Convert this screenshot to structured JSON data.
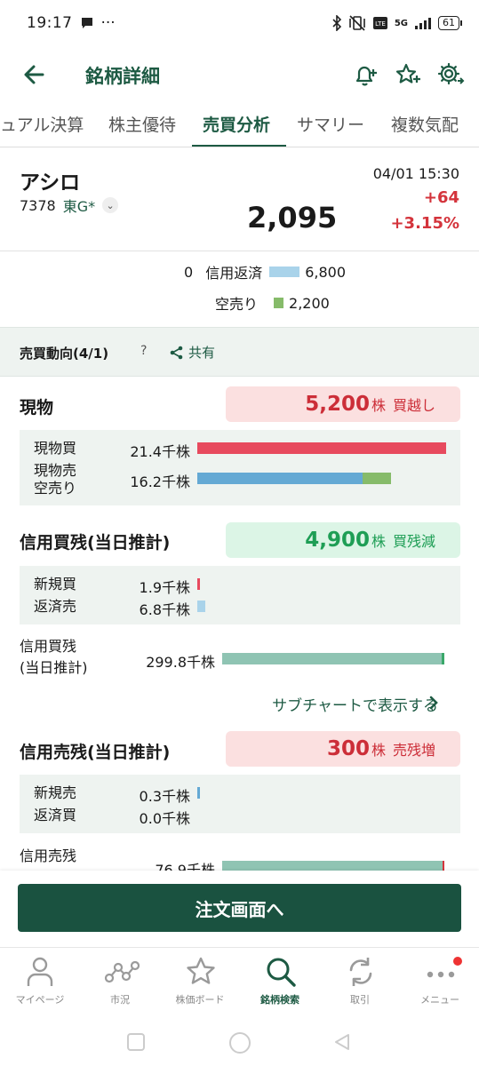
{
  "status_bar": {
    "time": "19:17",
    "dots": "···",
    "network": "5G",
    "battery": "61"
  },
  "header": {
    "title": "銘柄詳細"
  },
  "tabs": [
    {
      "label": "ュアル決算"
    },
    {
      "label": "株主優待"
    },
    {
      "label": "売買分析"
    },
    {
      "label": "サマリー"
    },
    {
      "label": "複数気配"
    }
  ],
  "stock": {
    "name": "アシロ",
    "code": "7378",
    "market": "東G*",
    "price": "2,095",
    "datetime": "04/01 15:30",
    "change": "+64",
    "change_pct": "+3.15%"
  },
  "credit": {
    "left_value": "0",
    "repay_label": "信用返済",
    "repay_value": "6,800",
    "short_label": "空売り",
    "short_value": "2,200",
    "colors": {
      "repay": "#a9d3ea",
      "short": "#86bb6a"
    }
  },
  "trend": {
    "title": "売買動向(4/1)",
    "help": "?",
    "share": "共有"
  },
  "spot": {
    "title": "現物",
    "summary_num": "5,200",
    "summary_unit": "株",
    "summary_label": "買越し",
    "buy_label": "現物買",
    "buy_value": "21.4千株",
    "sell_label_1": "現物売",
    "sell_label_2": "空売り",
    "sell_value": "16.2千株",
    "buy_fraction": 1.0,
    "sell_fraction": 0.663,
    "short_fraction": 0.114
  },
  "margin_buy": {
    "title": "信用買残(当日推計)",
    "summary_num": "4,900",
    "summary_unit": "株",
    "summary_label": "買残減",
    "new_label": "新規買",
    "new_value": "1.9千株",
    "repay_label": "返済売",
    "repay_value": "6.8千株",
    "total_label_1": "信用買残",
    "total_label_2": "(当日推計)",
    "total_value": "299.8千株",
    "link": "サブチャートで表示する"
  },
  "margin_sell": {
    "title": "信用売残(当日推計)",
    "summary_num": "300",
    "summary_unit": "株",
    "summary_label": "売残増",
    "new_label": "新規売",
    "new_value": "0.3千株",
    "repay_label": "返済買",
    "repay_value": "0.0千株",
    "total_label_1": "信用売残",
    "total_value": "76.9千株"
  },
  "order_button": "注文画面へ",
  "nav": [
    {
      "label": "マイページ",
      "icon": "person-icon"
    },
    {
      "label": "市況",
      "icon": "market-icon"
    },
    {
      "label": "株価ボード",
      "icon": "star-icon"
    },
    {
      "label": "銘柄検索",
      "icon": "search-icon"
    },
    {
      "label": "取引",
      "icon": "trade-icon"
    },
    {
      "label": "メニュー",
      "icon": "menu-icon"
    }
  ],
  "colors": {
    "brand": "#1d5a43",
    "positive": "#d4343c",
    "buy_bar": "#e74a5e",
    "sell_bar": "#64a9d4",
    "short_bar": "#86bb6a",
    "total_bar": "#8fc4b3"
  }
}
